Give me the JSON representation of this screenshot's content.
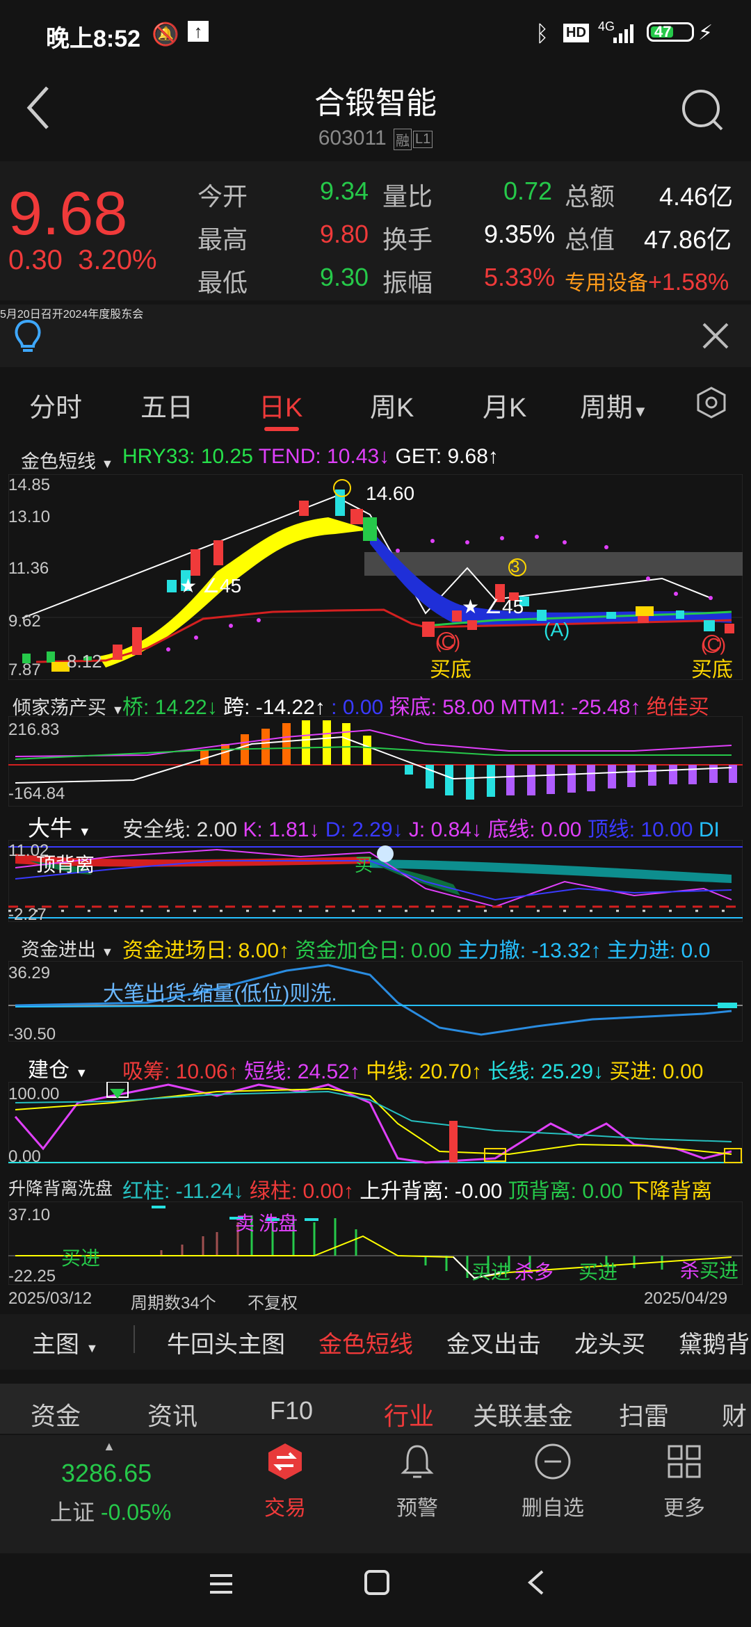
{
  "status_bar": {
    "time": "晚上8:52",
    "hd": "HD",
    "net": "4G",
    "battery": "47"
  },
  "header": {
    "title": "合锻智能",
    "code": "603011",
    "tag1": "融",
    "tag2": "L1"
  },
  "quote": {
    "price": "9.68",
    "change": "0.30",
    "change_pct": "3.20%",
    "rows": [
      {
        "l1": "今开",
        "v1": "9.34",
        "l2": "量比",
        "v2": "0.72",
        "l3": "总额",
        "v3": "4.46亿"
      },
      {
        "l1": "最高",
        "v1": "9.80",
        "l2": "换手",
        "v2": "9.35%",
        "l3": "总值",
        "v3": "47.86亿"
      },
      {
        "l1": "最低",
        "v1": "9.30",
        "l2": "振幅",
        "v2": "5.33%",
        "l3": "专用设备",
        "v3": "+1.58%"
      }
    ]
  },
  "notice": {
    "text": "5月20日召开2024年度股东会"
  },
  "tabs": [
    "分时",
    "五日",
    "日K",
    "周K",
    "月K",
    "周期"
  ],
  "active_tab": "日K",
  "main_panel": {
    "name": "金色短线",
    "i1": "HRY33: 10.25",
    "i2": "TEND: 10.43↓",
    "i3": "GET: 9.68↑",
    "y_ticks": [
      "14.85",
      "13.10",
      "11.36",
      "9.62",
      "7.87"
    ],
    "ann_top": "14.60",
    "ann_a": "∠45",
    "ann_b": "∠45",
    "ann_low": "8.12",
    "buy1": "买底",
    "buy2": "买底",
    "mark_a": "(A)",
    "mark_c1": "(C)",
    "mark_c2": "(C)",
    "mark_3": "3"
  },
  "panel2": {
    "name": "倾家荡产买",
    "i1": "桥: 14.22↓",
    "i2": "跨: -14.22↑",
    "i3": ": 0.00",
    "i4": "探底: 58.00",
    "i5": "MTM1: -25.48↑",
    "i6": "绝佳买",
    "y_top": "216.83",
    "y_bot": "-164.84"
  },
  "panel3": {
    "name": "大牛",
    "i1": "安全线: 2.00",
    "i2": "K: 1.81↓",
    "i3": "D: 2.29↓",
    "i4": "J: 0.84↓",
    "i5": "底线: 0.00",
    "i6": "顶线: 10.00",
    "i7": "DI",
    "y_top": "11.02",
    "y_bot": "-2.27",
    "ann1": "顶背离",
    "ann2": "买"
  },
  "panel4": {
    "name": "资金进出",
    "i1": "资金进场日: 8.00↑",
    "i2": "资金加仓日: 0.00",
    "i3": "主力撤: -13.32↑",
    "i4": "主力进: 0.0",
    "y_top": "36.29",
    "y_bot": "-30.50",
    "ann": "大笔出货.缩量(低位)则洗."
  },
  "panel5": {
    "name": "建仓",
    "i1": "吸筹: 10.06↑",
    "i2": "短线: 24.52↑",
    "i3": "中线: 20.70↑",
    "i4": "长线: 25.29↓",
    "i5": "买进: 0.00",
    "y_top": "100.00",
    "y_bot": "0.00"
  },
  "panel6": {
    "name": "升降背离洗盘",
    "i1": "红柱: -11.24↓",
    "i2": "绿柱: 0.00↑",
    "i3": "上升背离: -0.00",
    "i4": "顶背离: 0.00",
    "i5": "下降背离",
    "y_top": "37.10",
    "y_bot": "-22.25",
    "ann_sell": "卖",
    "ann_wash": "洗盘",
    "ann_buy1": "买进",
    "ann_buy2": "买进",
    "ann_buy3": "买进",
    "ann_kill1": "杀多",
    "ann_kill2": "杀",
    "ann_buy4": "买进"
  },
  "footer_info": {
    "date_start": "2025/03/12",
    "count": "周期数34个",
    "adj": "不复权",
    "date_end": "2025/04/29"
  },
  "sub_tabs": [
    "主图",
    "牛回头主图",
    "金色短线",
    "金叉出击",
    "龙头买",
    "黛鹅背"
  ],
  "active_sub_tab": "金色短线",
  "f_tabs": [
    "资金",
    "资讯",
    "F10",
    "行业",
    "关联基金",
    "扫雷",
    "财"
  ],
  "active_f_tab": "行业",
  "dock": {
    "index_value": "3286.65",
    "index_name": "上证",
    "index_chg": "-0.05%",
    "items": [
      "交易",
      "预警",
      "删自选",
      "更多"
    ]
  },
  "colors": {
    "up": "#f03a3a",
    "down": "#26c94a",
    "accent": "#f03a3a"
  }
}
